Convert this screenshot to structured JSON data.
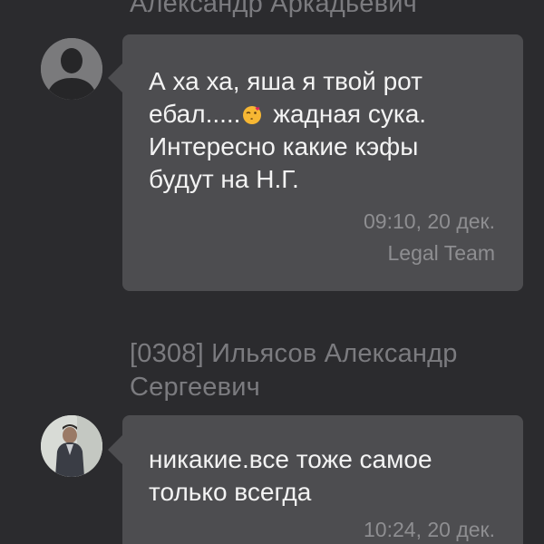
{
  "messages": [
    {
      "sender": "Александр Аркадьевич",
      "avatar": "default-user-silhouette",
      "text_before_emoji": "А ха ха, яша я твой рот\nебал.....",
      "emoji": "kissing-heart-emoji",
      "text_after_emoji": " жадная сука.\nИнтересно какие кэфы\nбудут на Н.Г.",
      "time": "09:10, 20 дек.",
      "team": "Legal Team"
    },
    {
      "sender": "[0308] Ильясов Александр\nСергеевич",
      "avatar": "user-photo",
      "text": "никакие.все тоже самое\nтолько всегда",
      "time": "10:24, 20 дек."
    }
  ],
  "colors": {
    "background": "#2b2b2e",
    "bubble": "#4d4d50",
    "message_text": "#f3f3f3",
    "meta_text": "#8e8e91",
    "sender_text": "#7b7b7f"
  }
}
